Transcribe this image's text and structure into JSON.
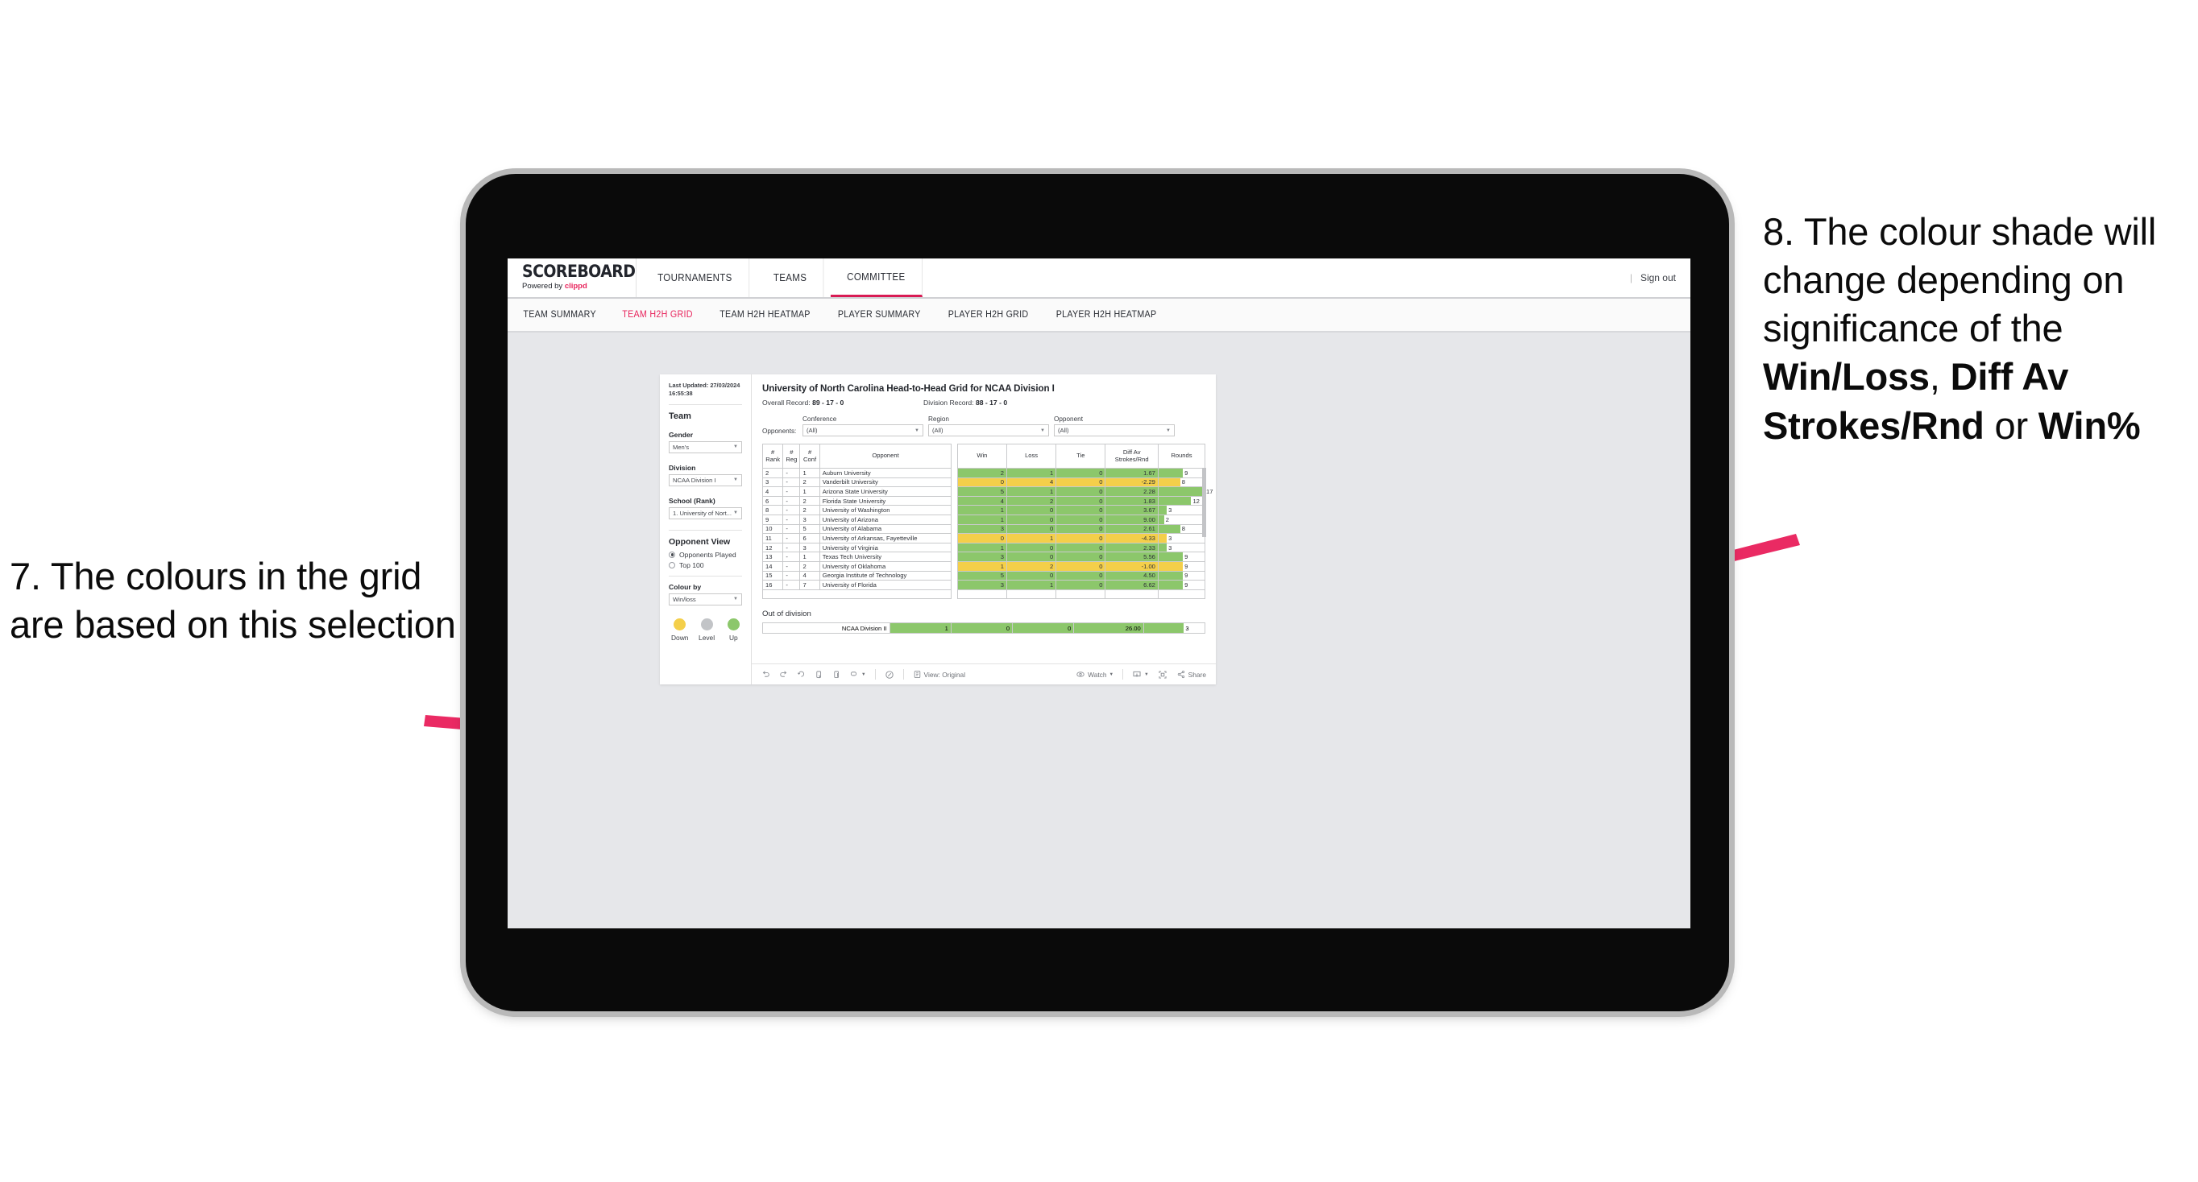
{
  "annotations": {
    "left": {
      "number": "7.",
      "text": "The colours in the grid are based on this selection"
    },
    "right": {
      "number": "8.",
      "prefix": "The colour shade will change depending on significance of the ",
      "bold1": "Win/Loss",
      "mid1": ", ",
      "bold2": "Diff Av Strokes/Rnd",
      "mid2": " or ",
      "bold3": "Win%"
    },
    "arrow_color": "#ea2a63"
  },
  "app": {
    "brand": {
      "name": "SCOREBOARD",
      "powered_prefix": "Powered by ",
      "powered_name": "clippd"
    },
    "top_nav": [
      {
        "label": "TOURNAMENTS",
        "active": false
      },
      {
        "label": "TEAMS",
        "active": false
      },
      {
        "label": "COMMITTEE",
        "active": true
      }
    ],
    "sign_out": {
      "divider": "|",
      "label": "Sign out"
    },
    "sub_nav": [
      {
        "label": "TEAM SUMMARY",
        "active": false
      },
      {
        "label": "TEAM H2H GRID",
        "active": true
      },
      {
        "label": "TEAM H2H HEATMAP",
        "active": false
      },
      {
        "label": "PLAYER SUMMARY",
        "active": false
      },
      {
        "label": "PLAYER H2H GRID",
        "active": false
      },
      {
        "label": "PLAYER H2H HEATMAP",
        "active": false
      }
    ]
  },
  "sidebar": {
    "last_updated": "Last Updated: 27/03/2024 16:55:38",
    "team_heading": "Team",
    "gender": {
      "label": "Gender",
      "value": "Men's"
    },
    "division": {
      "label": "Division",
      "value": "NCAA Division I"
    },
    "school": {
      "label": "School (Rank)",
      "value": "1. University of Nort..."
    },
    "opponent_view": {
      "heading": "Opponent View",
      "options": [
        {
          "label": "Opponents Played",
          "selected": true
        },
        {
          "label": "Top 100",
          "selected": false
        }
      ]
    },
    "colour_by": {
      "label": "Colour by",
      "value": "Win/loss"
    },
    "legend": [
      {
        "label": "Down",
        "color": "#f4cf4a"
      },
      {
        "label": "Level",
        "color": "#c2c4c7"
      },
      {
        "label": "Up",
        "color": "#8cc76b"
      }
    ]
  },
  "viz": {
    "title": "University of North Carolina Head-to-Head Grid for NCAA Division I",
    "overall_record_label": "Overall Record: ",
    "overall_record": "89 - 17 - 0",
    "division_record_label": "Division Record: ",
    "division_record": "88 - 17 - 0",
    "opponents_label": "Opponents:",
    "filters": [
      {
        "label": "Conference",
        "value": "(All)"
      },
      {
        "label": "Region",
        "value": "(All)"
      },
      {
        "label": "Opponent",
        "value": "(All)"
      }
    ],
    "out_of_division": {
      "heading": "Out of division",
      "row": {
        "name": "NCAA Division II",
        "win": "1",
        "loss": "0",
        "tie": "0",
        "diff": "26.00",
        "rounds": "3",
        "color": "up"
      }
    }
  },
  "chart_data": {
    "type": "table",
    "title": "University of North Carolina Head-to-Head Grid for NCAA Division I",
    "columns": [
      "# Rank",
      "# Reg",
      "# Conf",
      "Opponent",
      "Win",
      "Loss",
      "Tie",
      "Diff Av Strokes/Rnd",
      "Rounds"
    ],
    "column_header_lines": [
      [
        "#",
        "Rank"
      ],
      [
        "#",
        "Reg"
      ],
      [
        "#",
        "Conf"
      ],
      [
        "Opponent"
      ],
      [
        "Win"
      ],
      [
        "Loss"
      ],
      [
        "Tie"
      ],
      [
        "Diff Av",
        "Strokes/Rnd"
      ],
      [
        "Rounds"
      ]
    ],
    "rounds_max": 17,
    "colors": {
      "up": "#8cc76b",
      "down": "#f4cf4a",
      "level": "#c2c4c7"
    },
    "rows": [
      {
        "rank": "2",
        "reg": "-",
        "conf": "1",
        "opponent": "Auburn University",
        "win": "2",
        "loss": "1",
        "tie": "0",
        "diff": "1.67",
        "rounds": "9",
        "color": "up"
      },
      {
        "rank": "3",
        "reg": "-",
        "conf": "2",
        "opponent": "Vanderbilt University",
        "win": "0",
        "loss": "4",
        "tie": "0",
        "diff": "-2.29",
        "rounds": "8",
        "color": "down"
      },
      {
        "rank": "4",
        "reg": "-",
        "conf": "1",
        "opponent": "Arizona State University",
        "win": "5",
        "loss": "1",
        "tie": "0",
        "diff": "2.28",
        "rounds": "17",
        "color": "up"
      },
      {
        "rank": "6",
        "reg": "-",
        "conf": "2",
        "opponent": "Florida State University",
        "win": "4",
        "loss": "2",
        "tie": "0",
        "diff": "1.83",
        "rounds": "12",
        "color": "up"
      },
      {
        "rank": "8",
        "reg": "-",
        "conf": "2",
        "opponent": "University of Washington",
        "win": "1",
        "loss": "0",
        "tie": "0",
        "diff": "3.67",
        "rounds": "3",
        "color": "up"
      },
      {
        "rank": "9",
        "reg": "-",
        "conf": "3",
        "opponent": "University of Arizona",
        "win": "1",
        "loss": "0",
        "tie": "0",
        "diff": "9.00",
        "rounds": "2",
        "color": "up"
      },
      {
        "rank": "10",
        "reg": "-",
        "conf": "5",
        "opponent": "University of Alabama",
        "win": "3",
        "loss": "0",
        "tie": "0",
        "diff": "2.61",
        "rounds": "8",
        "color": "up"
      },
      {
        "rank": "11",
        "reg": "-",
        "conf": "6",
        "opponent": "University of Arkansas, Fayetteville",
        "win": "0",
        "loss": "1",
        "tie": "0",
        "diff": "-4.33",
        "rounds": "3",
        "color": "down"
      },
      {
        "rank": "12",
        "reg": "-",
        "conf": "3",
        "opponent": "University of Virginia",
        "win": "1",
        "loss": "0",
        "tie": "0",
        "diff": "2.33",
        "rounds": "3",
        "color": "up"
      },
      {
        "rank": "13",
        "reg": "-",
        "conf": "1",
        "opponent": "Texas Tech University",
        "win": "3",
        "loss": "0",
        "tie": "0",
        "diff": "5.56",
        "rounds": "9",
        "color": "up"
      },
      {
        "rank": "14",
        "reg": "-",
        "conf": "2",
        "opponent": "University of Oklahoma",
        "win": "1",
        "loss": "2",
        "tie": "0",
        "diff": "-1.00",
        "rounds": "9",
        "color": "down"
      },
      {
        "rank": "15",
        "reg": "-",
        "conf": "4",
        "opponent": "Georgia Institute of Technology",
        "win": "5",
        "loss": "0",
        "tie": "0",
        "diff": "4.50",
        "rounds": "9",
        "color": "up"
      },
      {
        "rank": "16",
        "reg": "-",
        "conf": "7",
        "opponent": "University of Florida",
        "win": "3",
        "loss": "1",
        "tie": "0",
        "diff": "6.62",
        "rounds": "9",
        "color": "up"
      }
    ]
  },
  "toolbar": {
    "view_label": "View: Original",
    "watch_label": "Watch",
    "share_label": "Share"
  }
}
